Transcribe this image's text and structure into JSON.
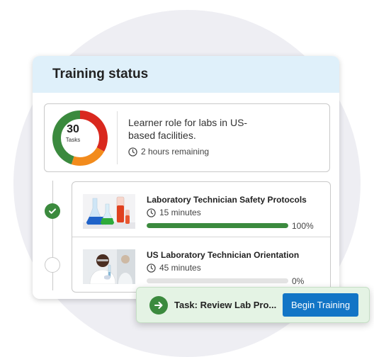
{
  "card": {
    "title": "Training status"
  },
  "summary": {
    "task_count": "30",
    "task_count_label": "Tasks",
    "donut_segments": [
      {
        "color": "#d9281e",
        "fraction": 0.33
      },
      {
        "color": "#f28b1c",
        "fraction": 0.22
      },
      {
        "color": "#3b8a3e",
        "fraction": 0.45
      }
    ],
    "description": "Learner role for labs in US-based facilities.",
    "time_remaining": "2 hours remaining"
  },
  "tasks": [
    {
      "title": "Laboratory Technician Safety Protocols",
      "duration": "15 minutes",
      "progress": 100,
      "progress_label": "100%",
      "status": "completed",
      "thumbnail": "lab-flasks-image"
    },
    {
      "title": "US Laboratory Technician Orientation",
      "duration": "45 minutes",
      "progress": 0,
      "progress_label": "0%",
      "status": "not-started",
      "thumbnail": "lab-technician-image"
    }
  ],
  "toast": {
    "text": "Task: Review Lab Pro...",
    "button_label": "Begin Training",
    "icon": "arrow-right-circle-icon"
  },
  "colors": {
    "accent_green": "#3b8a3e",
    "button_blue": "#1275c6",
    "header_bg": "#dff0fa"
  }
}
